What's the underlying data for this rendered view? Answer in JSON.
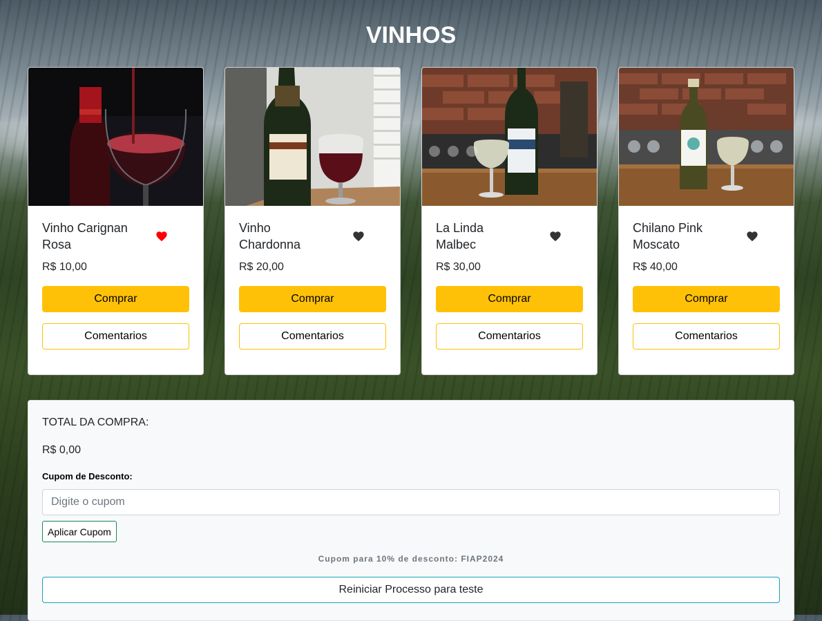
{
  "page": {
    "title": "VINHOS"
  },
  "products": [
    {
      "name": "Vinho Carignan Rosa",
      "price": "R$ 10,00",
      "favorite": true,
      "heart_color": "#ff0000",
      "buy_label": "Comprar",
      "comments_label": "Comentarios"
    },
    {
      "name": "Vinho Chardonna",
      "price": "R$ 20,00",
      "favorite": false,
      "heart_color": "#333333",
      "buy_label": "Comprar",
      "comments_label": "Comentarios"
    },
    {
      "name": "La Linda Malbec",
      "price": "R$ 30,00",
      "favorite": false,
      "heart_color": "#333333",
      "buy_label": "Comprar",
      "comments_label": "Comentarios"
    },
    {
      "name": "Chilano Pink Moscato",
      "price": "R$ 40,00",
      "favorite": false,
      "heart_color": "#333333",
      "buy_label": "Comprar",
      "comments_label": "Comentarios"
    }
  ],
  "summary": {
    "total_label": "TOTAL DA COMPRA:",
    "total_value": "R$ 0,00",
    "coupon_label": "Cupom de Desconto:",
    "coupon_placeholder": "Digite o cupom",
    "coupon_value": "",
    "apply_label": "Aplicar Cupom",
    "hint": "Cupom para 10% de desconto: FIAP2024",
    "reset_label": "Reiniciar Processo para teste"
  },
  "colors": {
    "accent_yellow": "#ffc107",
    "apply_border": "#198754",
    "reset_border": "#17a2b8",
    "heart_active": "#ff0000",
    "heart_inactive": "#333333"
  },
  "icons": [
    "heart-icon"
  ]
}
